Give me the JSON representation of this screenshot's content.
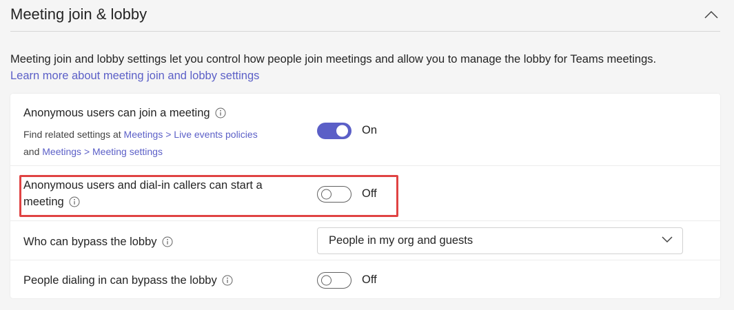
{
  "section": {
    "title": "Meeting join & lobby",
    "collapse_icon": "chevron-up-icon"
  },
  "description": {
    "text": "Meeting join and lobby settings let you control how people join meetings and allow you to manage the lobby for Teams meetings.",
    "link": "Learn more about meeting join and lobby settings"
  },
  "settings": {
    "anonymous_join": {
      "label": "Anonymous users can join a meeting",
      "sub_prefix": "Find related settings at ",
      "sub_link1": "Meetings > Live events policies",
      "sub_and": "and ",
      "sub_link2": "Meetings > Meeting settings",
      "state": "On"
    },
    "anonymous_start": {
      "label_line1": "Anonymous users and dial-in callers can start a",
      "label_line2": "meeting",
      "state": "Off"
    },
    "bypass_lobby": {
      "label": "Who can bypass the lobby",
      "selected": "People in my org and guests"
    },
    "dialin_bypass": {
      "label": "People dialing in can bypass the lobby",
      "state": "Off"
    }
  },
  "colors": {
    "accent": "#5b5fc7",
    "highlight": "#e04343"
  }
}
